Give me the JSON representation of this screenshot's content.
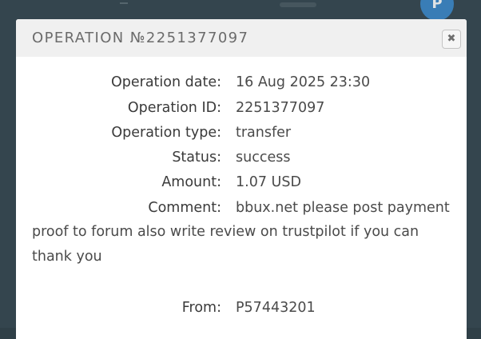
{
  "background": {
    "avatar_letter": "P"
  },
  "modal": {
    "title": "OPERATION №2251377097",
    "close_icon": "close-icon",
    "fields": {
      "date": {
        "label": "Operation date:",
        "value": "16 Aug 2025 23:30"
      },
      "id": {
        "label": "Operation ID:",
        "value": "2251377097"
      },
      "type": {
        "label": "Operation type:",
        "value": "transfer"
      },
      "status": {
        "label": "Status:",
        "value": "success"
      },
      "amount": {
        "label": "Amount:",
        "value": "1.07 USD"
      },
      "comment": {
        "label": "Comment:",
        "value_line1": "bbux.net please post payment",
        "value_rest": "proof to forum also write review on trustpilot if you can thank you"
      },
      "from": {
        "label": "From:",
        "value": "P57443201"
      }
    }
  }
}
